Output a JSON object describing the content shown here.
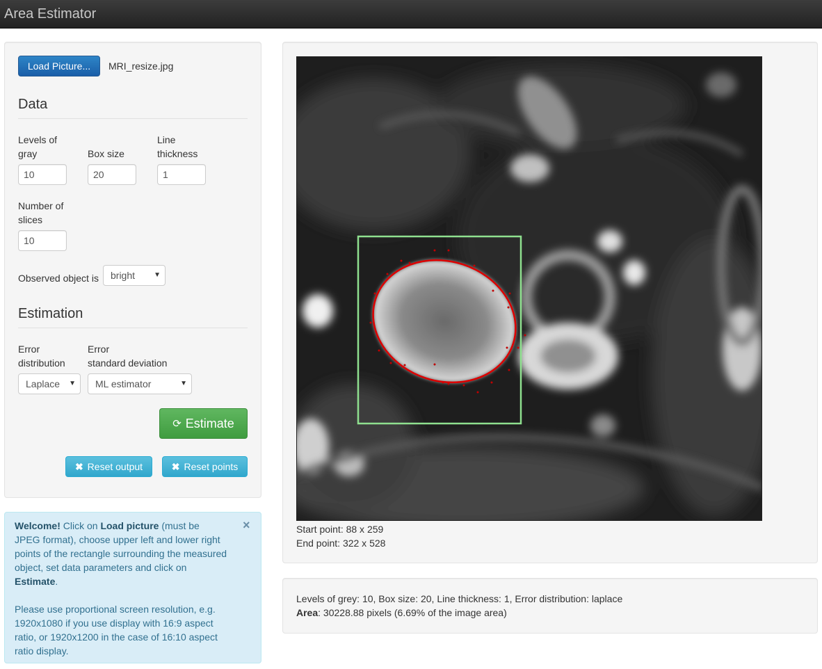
{
  "app": {
    "title": "Area Estimator"
  },
  "loader": {
    "button_label": "Load Picture...",
    "file_name": "MRI_resize.jpg"
  },
  "data_section": {
    "heading": "Data",
    "levels_label_1": "Levels of",
    "levels_label_2": "gray",
    "levels_value": "10",
    "box_label": "Box size",
    "box_value": "20",
    "thickness_label_1": "Line",
    "thickness_label_2": "thickness",
    "thickness_value": "1",
    "slices_label_1": "Number of",
    "slices_label_2": "slices",
    "slices_value": "10",
    "observed_label": "Observed object is",
    "observed_value": "bright"
  },
  "estimation_section": {
    "heading": "Estimation",
    "dist_label_1": "Error",
    "dist_label_2": "distribution",
    "dist_value": "Laplace",
    "sd_label_1": "Error",
    "sd_label_2": "standard deviation",
    "sd_value": "ML estimator",
    "estimate_label": "Estimate",
    "reset_output_label": "Reset output",
    "reset_points_label": "Reset points"
  },
  "welcome": {
    "strong_1": "Welcome!",
    "t1": " Click on ",
    "strong_2": "Load picture",
    "t2": " (must be",
    "l2": "JPEG format), choose upper left and lower right",
    "l3": "points of the rectangle surrounding the measured",
    "l4": "object, set data parameters and click on",
    "strong_3": "Estimate",
    "t3": ".",
    "p2_l1": "Please use proportional screen resolution, e.g.",
    "p2_l2": "1920x1080 if you use display with 16:9 aspect",
    "p2_l3": "ratio, or 1920x1200 in the case of 16:10 aspect",
    "p2_l4": "ratio display.",
    "close_glyph": "×"
  },
  "image_panel": {
    "start_point": "Start point: 88 x 259",
    "end_point": "End point: 322 x 528",
    "box_color": "#8fe08f",
    "ellipse_color": "#dd0000"
  },
  "result": {
    "params_line": "Levels of grey: 10, Box size: 20, Line thickness: 1, Error distribution: laplace",
    "area_label": "Area",
    "area_value": ": 30228.88 pixels (6.69% of the image area)"
  },
  "icons": {
    "refresh": "refresh-icon",
    "remove": "remove-icon"
  }
}
